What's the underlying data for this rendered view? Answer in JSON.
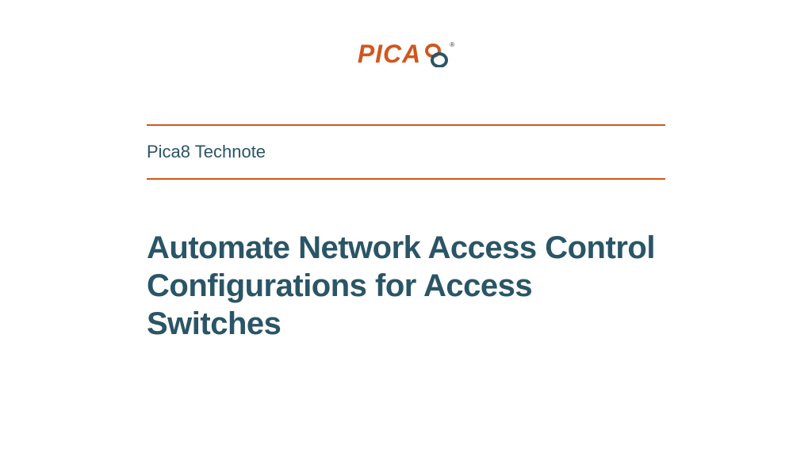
{
  "logo": {
    "brand_text": "PICA",
    "reg": "®"
  },
  "subtitle": "Pica8 Technote",
  "title": "Automate Network Access Control Configurations for Access Switches",
  "colors": {
    "accent": "#d1571d",
    "text_dark": "#2a5566"
  }
}
